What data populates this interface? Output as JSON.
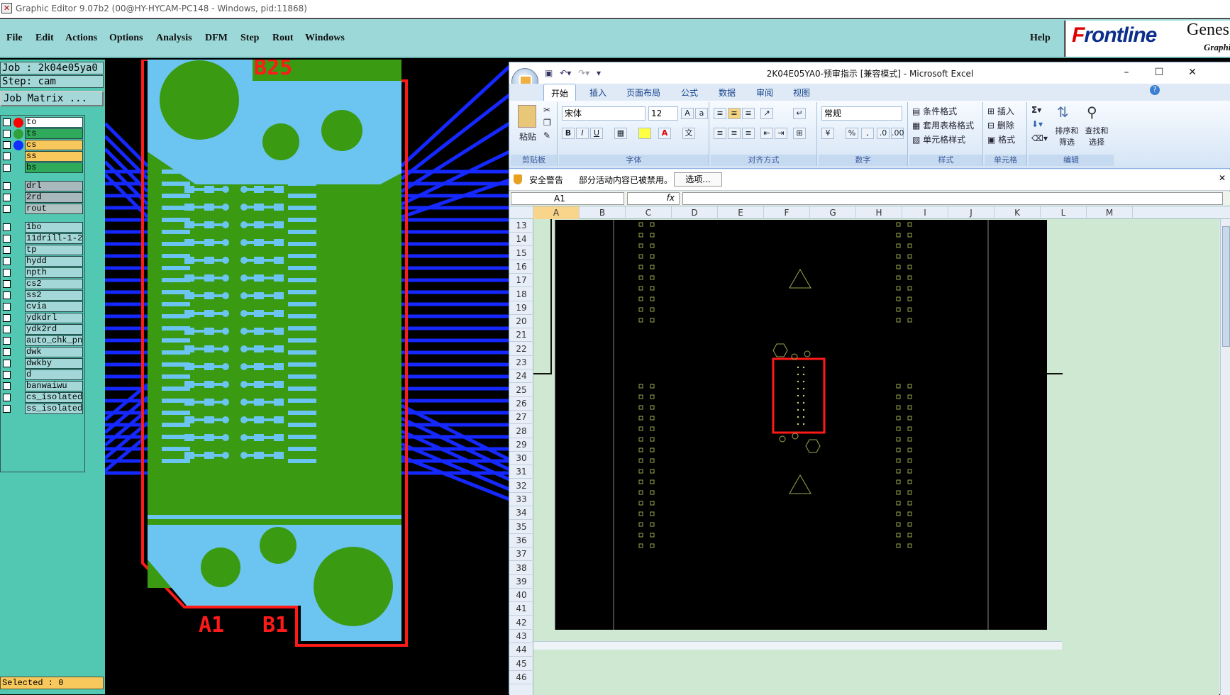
{
  "titlebar": {
    "text": "Graphic Editor 9.07b2 (00@HY-HYCAM-PC148 - Windows, pid:11868)"
  },
  "menubar": {
    "items": [
      "File",
      "Edit",
      "Actions",
      "Options",
      "Analysis",
      "DFM",
      "Step",
      "Rout",
      "Windows"
    ],
    "help": "Help"
  },
  "logo": {
    "brand_prefix": "F",
    "brand_rest": "rontline",
    "product": "Genes",
    "product_sub": "Graphi"
  },
  "leftpanel": {
    "job": "Job : 2k04e05ya0",
    "step": "Step: cam",
    "job_matrix": "Job Matrix ...",
    "selected": "Selected : 0",
    "layers": [
      {
        "name": "to",
        "bg": "#ffffff",
        "dot": "#ff0000"
      },
      {
        "name": "ts",
        "bg": "#2faa5a",
        "dot": "#2fa03a"
      },
      {
        "name": "cs",
        "bg": "#f8c85c",
        "dot": "#1030ff"
      },
      {
        "name": "ss",
        "bg": "#f8c85c",
        "dot": ""
      },
      {
        "name": "bs",
        "bg": "#2faa5a",
        "dot": ""
      },
      {
        "name": "drl",
        "bg": "#a8b8bc",
        "dot": ""
      },
      {
        "name": "2rd",
        "bg": "#a8b8bc",
        "dot": ""
      },
      {
        "name": "rout",
        "bg": "#b0c4c4",
        "dot": ""
      },
      {
        "name": "1bo",
        "bg": "#a4d8d8",
        "dot": ""
      },
      {
        "name": "11drill-1-2",
        "bg": "#a4d8d8",
        "dot": ""
      },
      {
        "name": "tp",
        "bg": "#a4d8d8",
        "dot": ""
      },
      {
        "name": "hydd",
        "bg": "#a4d8d8",
        "dot": ""
      },
      {
        "name": "npth",
        "bg": "#a4d8d8",
        "dot": ""
      },
      {
        "name": "cs2",
        "bg": "#a4d8d8",
        "dot": ""
      },
      {
        "name": "ss2",
        "bg": "#a4d8d8",
        "dot": ""
      },
      {
        "name": "cvia",
        "bg": "#a4d8d8",
        "dot": ""
      },
      {
        "name": "ydkdrl",
        "bg": "#a4d8d8",
        "dot": ""
      },
      {
        "name": "ydk2rd",
        "bg": "#a4d8d8",
        "dot": ""
      },
      {
        "name": "auto_chk_pn",
        "bg": "#a4d8d8",
        "dot": ""
      },
      {
        "name": "dwk",
        "bg": "#a4d8d8",
        "dot": ""
      },
      {
        "name": "dwkby",
        "bg": "#a4d8d8",
        "dot": ""
      },
      {
        "name": "d",
        "bg": "#a4d8d8",
        "dot": ""
      },
      {
        "name": "banwaiwu",
        "bg": "#a4d8d8",
        "dot": ""
      },
      {
        "name": "cs_isolated",
        "bg": "#a4d8d8",
        "dot": ""
      },
      {
        "name": "ss_isolated",
        "bg": "#a4d8d8",
        "dot": ""
      }
    ]
  },
  "pcb": {
    "labels": [
      "B25",
      "A1",
      "B1"
    ],
    "colors": {
      "copper": "#3a9a12",
      "mask": "#6cc4f0",
      "trace": "#1428ff",
      "outline": "#ff1a1a"
    }
  },
  "excel": {
    "title": "2K04E05YA0-预审指示  [兼容模式] - Microsoft Excel",
    "window_buttons": [
      "–",
      "☐",
      "✕"
    ],
    "tabs": [
      "开始",
      "插入",
      "页面布局",
      "公式",
      "数据",
      "审阅",
      "视图"
    ],
    "ribbon": {
      "paste": "粘贴",
      "clipboard": "剪贴板",
      "font_name": "宋体",
      "font_size": "12",
      "font_group": "字体",
      "align_group": "对齐方式",
      "number_format": "常规",
      "number_group": "数字",
      "cond_format": "条件格式",
      "table_format": "套用表格格式",
      "cell_style": "单元格样式",
      "styles_group": "样式",
      "insert": "插入",
      "delete": "删除",
      "format": "格式",
      "cells_group": "单元格",
      "sort_filter": "排序和筛选",
      "find_select": "查找和选择",
      "edit_group": "编辑",
      "bold": "B",
      "italic": "I",
      "underline": "U",
      "percent": "%",
      "comma": ","
    },
    "security": {
      "title": "安全警告",
      "message": "部分活动内容已被禁用。",
      "button": "选项..."
    },
    "namebox": "A1",
    "fx": "fx",
    "columns": [
      "A",
      "B",
      "C",
      "D",
      "E",
      "F",
      "G",
      "H",
      "I",
      "J",
      "K",
      "L",
      "M"
    ],
    "rows_start": 13,
    "rows_end": 46
  }
}
